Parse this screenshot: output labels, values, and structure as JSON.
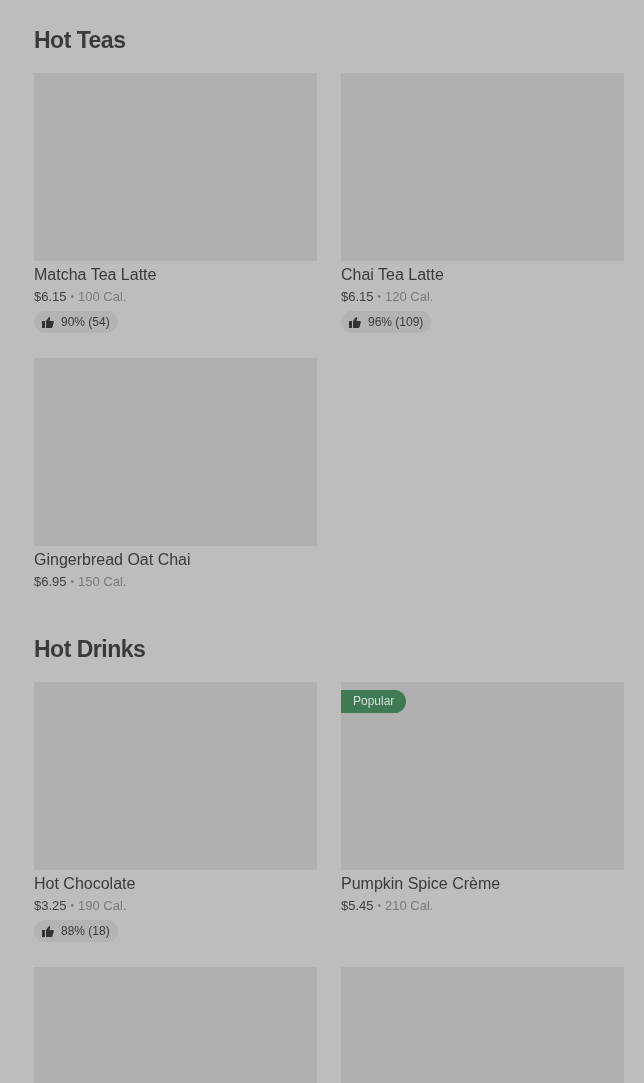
{
  "sections": [
    {
      "title": "Hot Teas",
      "items": [
        {
          "kind": "full",
          "name": "Matcha Tea Latte",
          "price": "$6.15",
          "separator": "•",
          "calories": "100 Cal.",
          "rating": "90% (54)"
        },
        {
          "kind": "full",
          "name": "Chai Tea Latte",
          "price": "$6.15",
          "separator": "•",
          "calories": "120 Cal.",
          "rating": "96% (109)"
        },
        {
          "kind": "full",
          "name": "Gingerbread Oat Chai",
          "price": "$6.95",
          "separator": "•",
          "calories": "150 Cal."
        }
      ]
    },
    {
      "title": "Hot Drinks",
      "items": [
        {
          "kind": "full",
          "name": "Hot Chocolate",
          "price": "$3.25",
          "separator": "•",
          "calories": "190 Cal.",
          "rating": "88% (18)"
        },
        {
          "kind": "full",
          "name": "Pumpkin Spice Crème",
          "price": "$5.45",
          "separator": "•",
          "calories": "210 Cal.",
          "badge": "Popular"
        },
        {
          "kind": "image_only"
        },
        {
          "kind": "image_only"
        }
      ]
    }
  ]
}
